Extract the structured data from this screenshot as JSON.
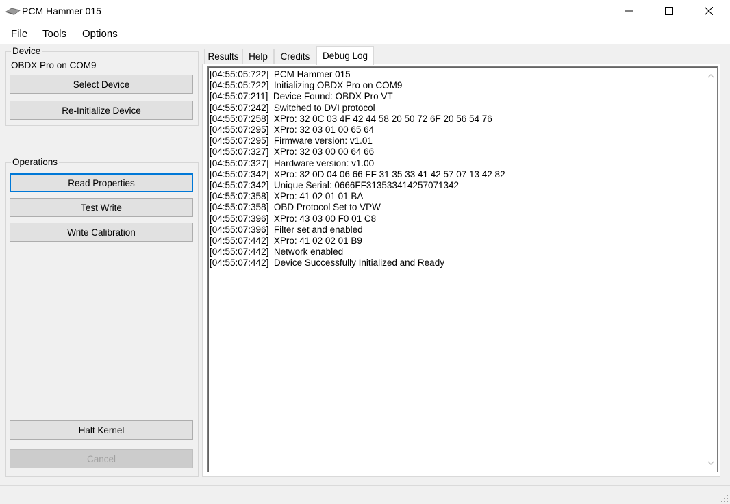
{
  "window": {
    "title": "PCM Hammer 015"
  },
  "menu": {
    "items": [
      "File",
      "Tools",
      "Options"
    ]
  },
  "device": {
    "group_title": "Device",
    "status": "OBDX Pro on COM9",
    "select_label": "Select Device",
    "reinit_label": "Re-Initialize Device"
  },
  "operations": {
    "group_title": "Operations",
    "read_label": "Read Properties",
    "test_label": "Test Write",
    "write_label": "Write Calibration",
    "halt_label": "Halt Kernel",
    "cancel_label": "Cancel"
  },
  "tabs": [
    "Results",
    "Help",
    "Credits",
    "Debug Log"
  ],
  "active_tab": "Debug Log",
  "log": [
    "[04:55:05:722]  PCM Hammer 015",
    "[04:55:05:722]  Initializing OBDX Pro on COM9",
    "[04:55:07:211]  Device Found: OBDX Pro VT",
    "[04:55:07:242]  Switched to DVI protocol",
    "[04:55:07:258]  XPro: 32 0C 03 4F 42 44 58 20 50 72 6F 20 56 54 76",
    "[04:55:07:295]  XPro: 32 03 01 00 65 64",
    "[04:55:07:295]  Firmware version: v1.01",
    "[04:55:07:327]  XPro: 32 03 00 00 64 66",
    "[04:55:07:327]  Hardware version: v1.00",
    "[04:55:07:342]  XPro: 32 0D 04 06 66 FF 31 35 33 41 42 57 07 13 42 82",
    "[04:55:07:342]  Unique Serial: 0666FF313533414257071342",
    "[04:55:07:358]  XPro: 41 02 01 01 BA",
    "[04:55:07:358]  OBD Protocol Set to VPW",
    "[04:55:07:396]  XPro: 43 03 00 F0 01 C8",
    "[04:55:07:396]  Filter set and enabled",
    "[04:55:07:442]  XPro: 41 02 02 01 B9",
    "[04:55:07:442]  Network enabled",
    "[04:55:07:442]  Device Successfully Initialized and Ready"
  ],
  "colors": {
    "focus_border": "#0078d7",
    "button_face": "#e1e1e1",
    "window_bg": "#f0f0f0"
  },
  "icons": [
    "app-icon",
    "minimize-icon",
    "maximize-icon",
    "close-icon",
    "scroll-up-icon",
    "scroll-down-icon",
    "size-grip-icon"
  ]
}
